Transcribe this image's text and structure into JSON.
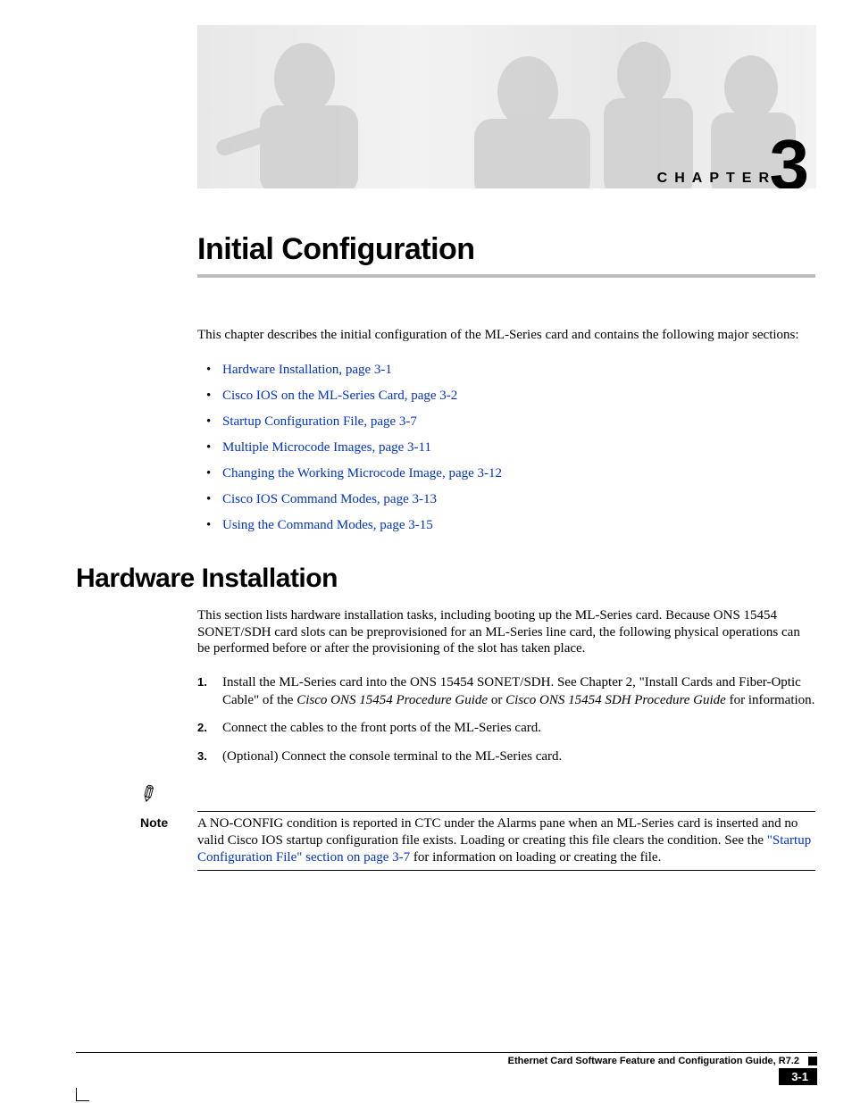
{
  "banner": {
    "chapter_label": "CHAPTER",
    "chapter_number": "3"
  },
  "title": "Initial Configuration",
  "intro": "This chapter describes the initial configuration of the ML-Series card and contains the following major sections:",
  "toc": [
    "Hardware Installation, page 3-1",
    "Cisco IOS on the ML-Series Card, page 3-2",
    "Startup Configuration File, page 3-7",
    "Multiple Microcode Images, page 3-11",
    "Changing the Working Microcode Image, page 3-12",
    "Cisco IOS Command Modes, page 3-13",
    "Using the Command Modes, page 3-15"
  ],
  "section1": {
    "heading": "Hardware Installation",
    "body": "This section lists hardware installation tasks, including booting up the ML-Series card. Because ONS 15454 SONET/SDH card slots can be preprovisioned for an ML-Series line card, the following physical operations can be performed before or after the provisioning of the slot has taken place.",
    "steps": {
      "s1a": "Install the ML-Series card into the ONS 15454 SONET/SDH. See Chapter 2, \"Install Cards and Fiber-Optic Cable\" of the ",
      "s1b": "Cisco ONS 15454 Procedure Guide",
      "s1c": " or ",
      "s1d": "Cisco ONS 15454 SDH Procedure Guide",
      "s1e": " for information.",
      "s2": "Connect the cables to the front ports of the ML-Series card.",
      "s3": "(Optional) Connect the console terminal to the ML-Series card."
    }
  },
  "note": {
    "label": "Note",
    "text_a": "A NO-CONFIG condition is reported in CTC under the Alarms pane when an ML-Series card is inserted and no valid Cisco IOS startup configuration file exists. Loading or creating this file clears the condition. See the ",
    "link": "\"Startup Configuration File\" section on page 3-7",
    "text_b": " for information on loading or creating the file."
  },
  "footer": {
    "guide_title": "Ethernet Card Software Feature and Configuration Guide, R7.2",
    "page_number": "3-1"
  }
}
